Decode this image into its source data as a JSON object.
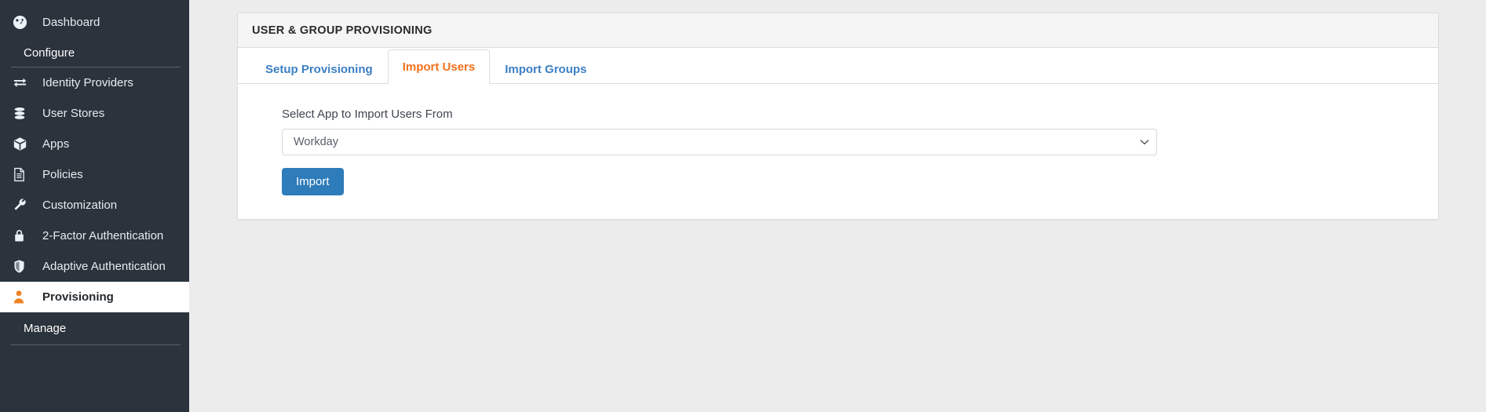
{
  "sidebar": {
    "dashboard": {
      "label": "Dashboard",
      "icon": "dashboard-icon"
    },
    "configure_heading": "Configure",
    "manage_heading": "Manage",
    "items": [
      {
        "label": "Identity Providers",
        "icon": "exchange-icon",
        "active": false
      },
      {
        "label": "User Stores",
        "icon": "database-icon",
        "active": false
      },
      {
        "label": "Apps",
        "icon": "cube-icon",
        "active": false
      },
      {
        "label": "Policies",
        "icon": "document-icon",
        "active": false
      },
      {
        "label": "Customization",
        "icon": "wrench-icon",
        "active": false
      },
      {
        "label": "2-Factor Authentication",
        "icon": "lock-icon",
        "active": false
      },
      {
        "label": "Adaptive Authentication",
        "icon": "shield-icon",
        "active": false
      },
      {
        "label": "Provisioning",
        "icon": "user-icon",
        "active": true
      }
    ]
  },
  "panel": {
    "title": "USER & GROUP PROVISIONING",
    "tabs": [
      {
        "label": "Setup Provisioning",
        "active": false
      },
      {
        "label": "Import Users",
        "active": true
      },
      {
        "label": "Import Groups",
        "active": false
      }
    ],
    "form": {
      "select_label": "Select App to Import Users From",
      "select_value": "Workday",
      "select_options": [
        "Workday"
      ],
      "import_button": "Import"
    }
  },
  "colors": {
    "sidebar_bg": "#2b333c",
    "accent_orange": "#f3701b",
    "link_blue": "#3b7fc4",
    "button_blue": "#2e7cba",
    "page_bg": "#ececec"
  }
}
